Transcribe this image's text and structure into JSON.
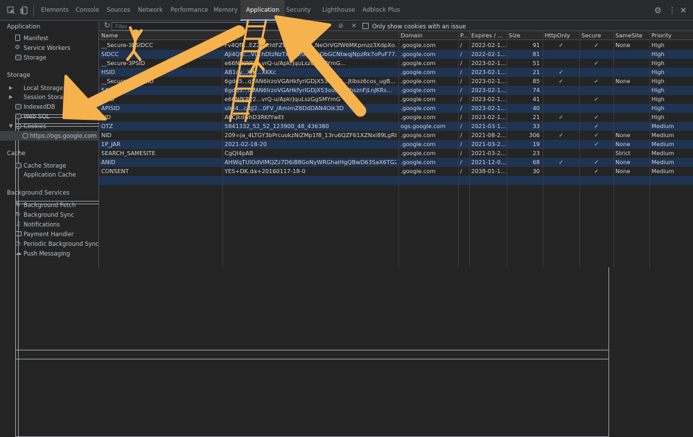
{
  "tabs": [
    "Elements",
    "Console",
    "Sources",
    "Network",
    "Performance",
    "Memory",
    "Application",
    "Security",
    "Lighthouse",
    "Adblock Plus"
  ],
  "active_tab": "Application",
  "toolbar": {
    "settings_icon": "gear-icon",
    "more_icon": "kebab-icon",
    "close_icon": "close-icon"
  },
  "sidebar": {
    "application_header": "Application",
    "application_items": [
      "Manifest",
      "Service Workers",
      "Storage"
    ],
    "storage_header": "Storage",
    "storage_items": [
      "Local Storage",
      "Session Storage",
      "IndexedDB",
      "Web SQL",
      "Cookies"
    ],
    "cookie_origin": "https://ogs.google.com",
    "cache_header": "Cache",
    "cache_items": [
      "Cache Storage",
      "Application Cache"
    ],
    "background_header": "Background Services",
    "background_items": [
      "Background Fetch",
      "Background Sync",
      "Notifications",
      "Payment Handler",
      "Periodic Background Sync",
      "Push Messaging"
    ]
  },
  "cookies_toolbar": {
    "filter_placeholder": "Filter",
    "issue_checkbox_label": "Only show cookies with an issue"
  },
  "columns": [
    "Name",
    "Value",
    "Domain",
    "P...",
    "Expires / ...",
    "Size",
    "HttpOnly",
    "Secure",
    "SameSite",
    "Priority"
  ],
  "rows": [
    {
      "name": "__Secure-3PSIDCC",
      "value": "Fv4QfP...EZZ3...htFZWI...bl0cy...NeOrVGfW6MKpmzz3XdpXo...",
      "domain": ".google.com",
      "path": "/",
      "expires": "2022-02-1...",
      "size": "91",
      "httponly": "✓",
      "secure": "✓",
      "samesite": "None",
      "priority": "High"
    },
    {
      "name": "SIDCC",
      "value": "AJi4QfE...Vi...hDtzNzTxWI...u...ohrObGCNtwqjNpzRk7oPuF77...",
      "domain": ".google.com",
      "path": "/",
      "expires": "2022-02-1...",
      "size": "81",
      "httponly": "",
      "secure": "",
      "samesite": "",
      "priority": "High"
    },
    {
      "name": "__Secure-3PSID",
      "value": "e66NfKRP2...vrQ-u/ApkrJquLszGgSMYmG...",
      "domain": ".google.com",
      "path": "/",
      "expires": "2023-02-1...",
      "size": "51",
      "httponly": "",
      "secure": "✓",
      "samesite": "",
      "priority": "High"
    },
    {
      "name": "HSID",
      "value": "AB1cy...XjK...XKKc",
      "domain": ".google.com",
      "path": "/",
      "expires": "2023-02-1...",
      "size": "21",
      "httponly": "✓",
      "secure": "",
      "samesite": "",
      "priority": "High"
    },
    {
      "name": "__Secure-3PAPISID",
      "value": "6gdu5...qVAN6IrzoVGAHkfyrIGDjX53ouN3...Jtlbsz6cos_ugB...",
      "domain": ".google.com",
      "path": "/",
      "expires": "2023-02-1...",
      "size": "85",
      "httponly": "✓",
      "secure": "✓",
      "samesite": "None",
      "priority": "High"
    },
    {
      "name": "SAPISID",
      "value": "6gdu5...qVAN6IrzoVGAHkfyrIGDjX53ouN3...lbsznFjLnJKRs...",
      "domain": ".google.com",
      "path": "/",
      "expires": "2023-02-1...",
      "size": "74",
      "httponly": "",
      "secure": "",
      "samesite": "",
      "priority": "High"
    },
    {
      "name": "SSID",
      "value": "e66NfKRP2...vrQ-u/ApkrJquLszGgSMYmG",
      "domain": ".google.com",
      "path": "/",
      "expires": "2023-02-1...",
      "size": "41",
      "httponly": "",
      "secure": "✓",
      "samesite": "",
      "priority": "High"
    },
    {
      "name": "APISID",
      "value": "uloJ4...cdjJ2...0FV_/AmimZ6DdDAN4Oik3D",
      "domain": ".google.com",
      "path": "/",
      "expires": "2023-02-1...",
      "size": "40",
      "httponly": "",
      "secure": "",
      "samesite": "",
      "priority": "High"
    },
    {
      "name": "SID",
      "value": "AKCjkdwhD3RKfYwEt",
      "domain": ".google.com",
      "path": "/",
      "expires": "2023-02-1...",
      "size": "21",
      "httponly": "✓",
      "secure": "✓",
      "samesite": "",
      "priority": "High"
    },
    {
      "name": "OTZ",
      "value": "5841332_52_52_123900_48_436380",
      "domain": "ogs.google.com",
      "path": "/",
      "expires": "2021-03-1...",
      "size": "33",
      "httponly": "",
      "secure": "✓",
      "samesite": "",
      "priority": "Medium"
    },
    {
      "name": "NID",
      "value": "209=ja_4LTGY3bPrcuokzNiZMp1f8_13ru6QZF61XZNxi89LgR8z8Flx...",
      "domain": ".google.com",
      "path": "/",
      "expires": "2021-08-2...",
      "size": "306",
      "httponly": "✓",
      "secure": "✓",
      "samesite": "None",
      "priority": "Medium"
    },
    {
      "name": "1P_JAR",
      "value": "2021-02-18-20",
      "domain": ".google.com",
      "path": "/",
      "expires": "2021-03-2...",
      "size": "19",
      "httponly": "",
      "secure": "✓",
      "samesite": "None",
      "priority": "Medium"
    },
    {
      "name": "SEARCH_SAMESITE",
      "value": "CgQI4pAB",
      "domain": ".google.com",
      "path": "/",
      "expires": "2021-03-2...",
      "size": "23",
      "httponly": "",
      "secure": "",
      "samesite": "Strict",
      "priority": "Medium"
    },
    {
      "name": "ANID",
      "value": "AHWqTUlOdViMQZz7D6iB8GoNyWRGhalHgQBwD63SaX6TG2yKT...",
      "domain": ".google.com",
      "path": "/",
      "expires": "2021-12-0...",
      "size": "68",
      "httponly": "✓",
      "secure": "✓",
      "samesite": "None",
      "priority": "Medium"
    },
    {
      "name": "CONSENT",
      "value": "YES+DK.da+20160117-18-0",
      "domain": ".google.com",
      "path": "/",
      "expires": "2038-01-1...",
      "size": "30",
      "httponly": "",
      "secure": "✓",
      "samesite": "None",
      "priority": "Medium"
    }
  ],
  "annotation": {
    "arrow_color": "#f6b24c",
    "figure_color": "#f6b24c"
  }
}
